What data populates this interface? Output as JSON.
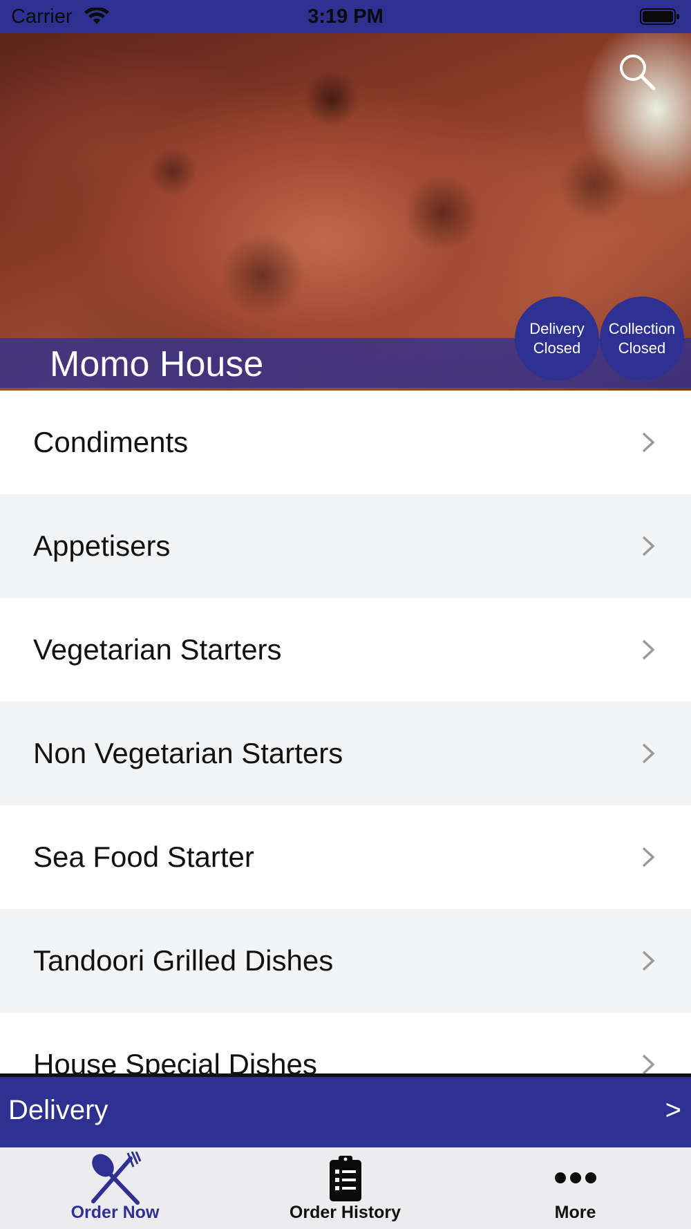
{
  "status_bar": {
    "carrier": "Carrier",
    "time": "3:19 PM"
  },
  "header": {
    "restaurant_name": "Momo House",
    "delivery_status": {
      "line1": "Delivery",
      "line2": "Closed"
    },
    "collection_status": {
      "line1": "Collection",
      "line2": "Closed"
    }
  },
  "categories": [
    {
      "label": "Condiments"
    },
    {
      "label": "Appetisers"
    },
    {
      "label": "Vegetarian Starters"
    },
    {
      "label": "Non Vegetarian Starters"
    },
    {
      "label": "Sea Food Starter"
    },
    {
      "label": "Tandoori Grilled Dishes"
    },
    {
      "label": "House Special Dishes"
    }
  ],
  "order_mode_bar": {
    "label": "Delivery",
    "arrow": ">"
  },
  "tab_bar": {
    "tabs": [
      {
        "label": "Order Now",
        "icon": "fork-knife-icon",
        "active": true
      },
      {
        "label": "Order History",
        "icon": "clipboard-list-icon",
        "active": false
      },
      {
        "label": "More",
        "icon": "more-dots-icon",
        "active": false
      }
    ]
  },
  "colors": {
    "brand": "#2e3192",
    "row_alt": "#f3f4f6",
    "tab_bar_bg": "#ececee"
  }
}
